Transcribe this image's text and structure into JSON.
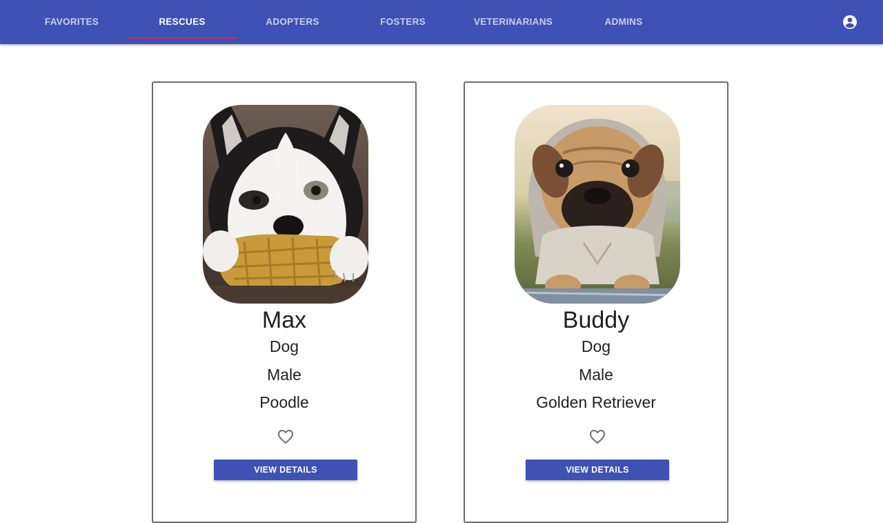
{
  "nav": {
    "tabs": [
      {
        "label": "FAVORITES"
      },
      {
        "label": "RESCUES"
      },
      {
        "label": "ADOPTERS"
      },
      {
        "label": "FOSTERS"
      },
      {
        "label": "VETERINARIANS"
      },
      {
        "label": "ADMINS"
      }
    ],
    "active_tab": "RESCUES",
    "account_icon": "account-circle-icon"
  },
  "rescues": [
    {
      "name": "Max",
      "species": "Dog",
      "gender": "Male",
      "breed": "Poodle",
      "favorite_icon": "heart-outline-icon",
      "button_label": "VIEW DETAILS"
    },
    {
      "name": "Buddy",
      "species": "Dog",
      "gender": "Male",
      "breed": "Golden Retriever",
      "favorite_icon": "heart-outline-icon",
      "button_label": "VIEW DETAILS"
    }
  ],
  "colors": {
    "primary": "#3f51b5",
    "accent": "#e91e63"
  }
}
